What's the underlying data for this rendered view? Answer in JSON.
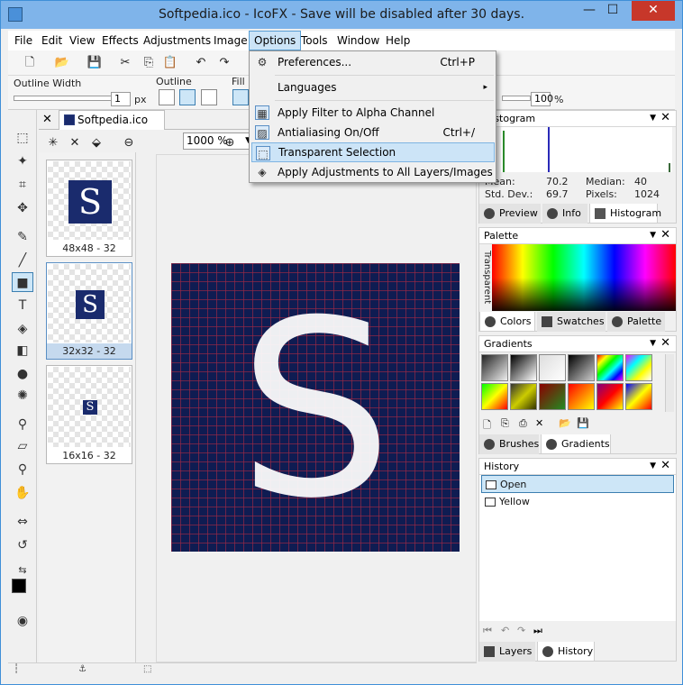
{
  "window": {
    "title": "Softpedia.ico - IcoFX - Save will be disabled after 30 days.",
    "min_glyph": "—",
    "max_glyph": "☐",
    "close_glyph": "✕"
  },
  "menu": [
    {
      "label": "File"
    },
    {
      "label": "Edit"
    },
    {
      "label": "View"
    },
    {
      "label": "Effects"
    },
    {
      "label": "Adjustments"
    },
    {
      "label": "Image"
    },
    {
      "label": "Options"
    },
    {
      "label": "Tools"
    },
    {
      "label": "Window"
    },
    {
      "label": "Help"
    }
  ],
  "options_menu": {
    "items": [
      {
        "label": "Preferences...",
        "shortcut": "Ctrl+P",
        "icon": "gear-icon"
      },
      {
        "label": "Languages",
        "shortcut": "",
        "icon": "",
        "submenu": "▸"
      },
      {
        "label": "Apply Filter to Alpha Channel",
        "shortcut": "",
        "icon": "alpha-filter-icon"
      },
      {
        "label": "Antialiasing On/Off",
        "shortcut": "Ctrl+/",
        "icon": "antialias-icon"
      },
      {
        "label": "Transparent Selection",
        "shortcut": "",
        "icon": "transparent-selection-icon"
      },
      {
        "label": "Apply Adjustments to All Layers/Images",
        "shortcut": "",
        "icon": "layers-icon"
      }
    ]
  },
  "options_bar": {
    "outline_width_label": "Outline Width",
    "outline_width_value": "1",
    "outline_width_unit": "px",
    "outline_label": "Outline",
    "fill_label": "Fill",
    "opacity_value": "100",
    "opacity_unit": "%"
  },
  "document": {
    "tab_name": "Softpedia.ico",
    "zoom": "1000 %",
    "thumbnails": [
      {
        "caption": "48x48 - 32",
        "glyph": "S"
      },
      {
        "caption": "32x32 - 32",
        "glyph": "S"
      },
      {
        "caption": "16x16 - 32",
        "glyph": "S"
      }
    ],
    "canvas_glyph": "S"
  },
  "histogram_panel": {
    "title": "Histogram",
    "mean_label": "Mean:",
    "mean_value": "70.2",
    "median_label": "Median:",
    "median_value": "40",
    "stddev_label": "Std. Dev.:",
    "stddev_value": "69.7",
    "pixels_label": "Pixels:",
    "pixels_value": "1024",
    "tabs": [
      "Preview",
      "Info",
      "Histogram"
    ]
  },
  "palette_panel": {
    "title": "Palette",
    "transparent_label": "Transparent",
    "tabs": [
      "Colors",
      "Swatches",
      "Palette"
    ]
  },
  "gradients_panel": {
    "title": "Gradients",
    "tabs": [
      "Brushes",
      "Gradients"
    ]
  },
  "history_panel": {
    "title": "History",
    "items": [
      "Open",
      "Yellow"
    ],
    "tabs": [
      "Layers",
      "History"
    ]
  },
  "glyphs": {
    "pin": "▼",
    "close": "✕"
  }
}
